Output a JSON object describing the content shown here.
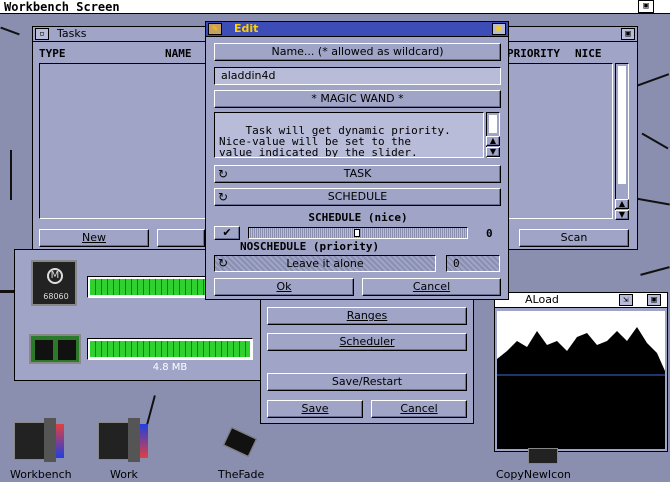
{
  "screen": {
    "title": "Workbench Screen"
  },
  "tasks": {
    "title": "Tasks",
    "columns": [
      "TYPE",
      "NAME",
      "PRIORITY",
      "NICE"
    ],
    "buttons": {
      "new": "New",
      "scan": "Scan"
    }
  },
  "edit": {
    "title": "Edit",
    "name_button": "Name... (* allowed as wildcard)",
    "name_value": "aladdin4d",
    "magic_wand": "* MAGIC WAND *",
    "help_text": "Task will get dynamic priority.\nNice-value will be set to the\nvalue indicated by the slider.",
    "cycle1": "TASK",
    "cycle2": "SCHEDULE",
    "schedule_label": "SCHEDULE (nice)",
    "slider_value": 0,
    "slider_value_text": "0",
    "noschedule_label": "NOSCHEDULE (priority)",
    "leave_label": "Leave it alone",
    "leave_value": "0",
    "ok": "Ok",
    "cancel": "Cancel"
  },
  "monitor": {
    "cpu_label": "68060",
    "cpu_load": 1.0,
    "mem_load": 1.0,
    "mem_text": "4.8 MB"
  },
  "prefs": {
    "ranges": "Ranges",
    "scheduler": "Scheduler",
    "save_restart": "Save/Restart",
    "save": "Save",
    "cancel": "Cancel"
  },
  "aload": {
    "title": "ALoad"
  },
  "icons": [
    {
      "label": "Workbench",
      "icon": "workbench-drive-icon"
    },
    {
      "label": "Work",
      "icon": "work-drive-icon"
    },
    {
      "label": "TheFade",
      "icon": "chip-icon"
    },
    {
      "label": "CopyNewIcon",
      "icon": "tool-icon"
    }
  ],
  "colors": {
    "active_title": "#3c4db8",
    "title_text": "#ffd000",
    "bar_green": "#30d030",
    "window": "#a0a5c8",
    "desktop": "#8a8fb0"
  }
}
